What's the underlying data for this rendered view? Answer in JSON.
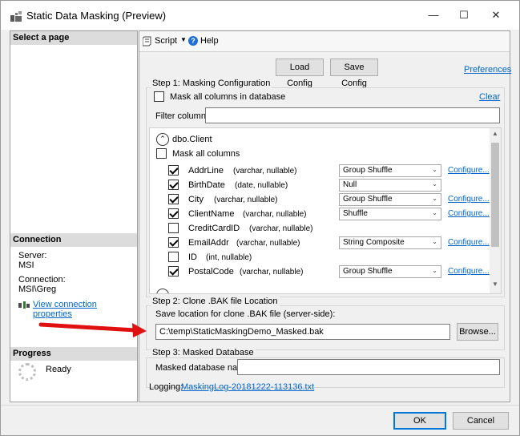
{
  "window": {
    "title": "Static Data Masking (Preview)",
    "minimize_glyph": "—",
    "maximize_glyph": "☐",
    "close_glyph": "✕"
  },
  "left_pane": {
    "select_page_header": "Select a page",
    "connection_header": "Connection",
    "server_label": "Server:",
    "server_value": "MSI",
    "connection_label": "Connection:",
    "connection_value": "MSI\\Greg",
    "view_connection_link": "View connection properties",
    "progress_header": "Progress",
    "progress_status": "Ready"
  },
  "toolbar": {
    "script_label": "Script",
    "help_label": "Help"
  },
  "top_buttons": {
    "load_config": "Load Config",
    "save_config": "Save Config",
    "preferences_link": "Preferences"
  },
  "step1": {
    "title": "Step 1: Masking Configuration",
    "mask_all_db_label": "Mask all columns in database",
    "mask_all_db_checked": false,
    "clear_link": "Clear",
    "filter_label": "Filter columns:",
    "filter_value": "",
    "table_name": "dbo.Client",
    "mask_all_table_label": "Mask all columns",
    "mask_all_table_checked": false,
    "columns": [
      {
        "name": "AddrLine",
        "type": "(varchar, nullable)",
        "checked": true,
        "mask": "Group Shuffle",
        "configure": "Configure..."
      },
      {
        "name": "BirthDate",
        "type": "(date, nullable)",
        "checked": true,
        "mask": "Null",
        "configure": ""
      },
      {
        "name": "City",
        "type": "(varchar, nullable)",
        "checked": true,
        "mask": "Group Shuffle",
        "configure": "Configure..."
      },
      {
        "name": "ClientName",
        "type": "(varchar, nullable)",
        "checked": true,
        "mask": "Shuffle",
        "configure": "Configure..."
      },
      {
        "name": "CreditCardID",
        "type": "(varchar, nullable)",
        "checked": false,
        "mask": "",
        "configure": ""
      },
      {
        "name": "EmailAddr",
        "type": "(varchar, nullable)",
        "checked": true,
        "mask": "String Composite",
        "configure": "Configure..."
      },
      {
        "name": "ID",
        "type": "(int, nullable)",
        "checked": false,
        "mask": "",
        "configure": ""
      },
      {
        "name": "PostalCode",
        "type": "(varchar, nullable)",
        "checked": true,
        "mask": "Group Shuffle",
        "configure": "Configure..."
      }
    ]
  },
  "step2": {
    "title": "Step 2: Clone .BAK file Location",
    "save_location_label": "Save location for clone .BAK file (server-side):",
    "path_value": "C:\\temp\\StaticMaskingDemo_Masked.bak",
    "browse_button": "Browse..."
  },
  "step3": {
    "title": "Step 3: Masked Database",
    "db_name_label": "Masked database name:",
    "db_name_value": ""
  },
  "logging": {
    "label": "Logging:",
    "link": "MaskingLog-20181222-113136.txt"
  },
  "footer": {
    "ok_button": "OK",
    "cancel_button": "Cancel"
  },
  "colors": {
    "link": "#0066cc",
    "accent": "#0078d7",
    "annotation_arrow": "#e01010"
  }
}
